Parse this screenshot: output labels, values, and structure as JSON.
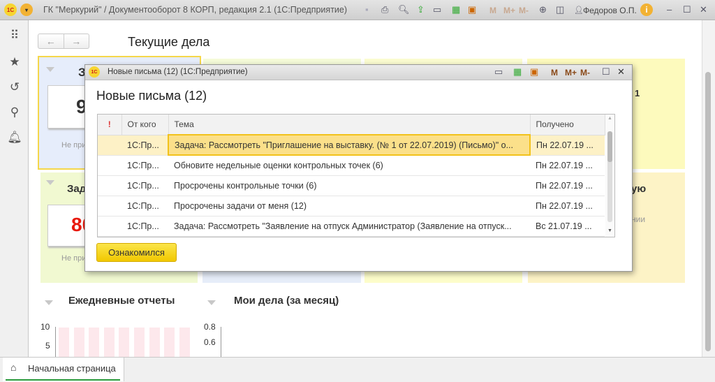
{
  "titlebar": {
    "title": "ГК \"Меркурий\" / Документооборот 8 КОРП, редакция 2.1  (1С:Предприятие)",
    "logo": "1С",
    "user": "Федоров О.П.",
    "memory": [
      "M",
      "M+",
      "M-"
    ]
  },
  "sidebar": {
    "icons": [
      "apps-grid-icon",
      "star-icon",
      "history-icon",
      "search-icon",
      "bell-icon"
    ]
  },
  "page": {
    "title": "Текущие дела",
    "back": "←",
    "forward": "→"
  },
  "tiles": {
    "r1t1": {
      "title": "З",
      "value": "9",
      "note": "Не при"
    },
    "r1t4": {
      "text": ": 1"
    },
    "r2t1": {
      "title": "Зад",
      "value": "80",
      "note": "Не при"
    },
    "r2t4": {
      "title": "ую",
      "note": "нии"
    }
  },
  "charts": [
    {
      "title": "Ежедневные отчеты",
      "ticks": [
        "10",
        "5"
      ]
    },
    {
      "title": "Мои дела (за месяц)",
      "ticks": [
        "0.8",
        "0.6"
      ]
    }
  ],
  "chart_data": [
    {
      "type": "bar",
      "title": "Ежедневные отчеты",
      "yticks": [
        10,
        5
      ],
      "bar_count": 9,
      "color": "#fde8ec"
    },
    {
      "type": "line",
      "title": "Мои дела (за месяц)",
      "yticks": [
        0.8,
        0.6
      ]
    }
  ],
  "dialog": {
    "window_title": "Новые письма (12)  (1С:Предприятие)",
    "heading": "Новые письма (12)",
    "columns": {
      "importance": "!",
      "from": "От кого",
      "subject": "Тема",
      "received": "Получено"
    },
    "rows": [
      {
        "from": "1С:Пр...",
        "subject": "Задача: Рассмотреть \"Приглашение на выставку. (№ 1 от 22.07.2019) (Письмо)\" о...",
        "received": "Пн 22.07.19 ..."
      },
      {
        "from": "1С:Пр...",
        "subject": "Обновите недельные оценки контрольных точек (6)",
        "received": "Пн 22.07.19 ..."
      },
      {
        "from": "1С:Пр...",
        "subject": "Просрочены контрольные точки (6)",
        "received": "Пн 22.07.19 ..."
      },
      {
        "from": "1С:Пр...",
        "subject": "Просрочены задачи от меня (12)",
        "received": "Пн 22.07.19 ..."
      },
      {
        "from": "1С:Пр...",
        "subject": "Задача: Рассмотреть \"Заявление на отпуск Администратор (Заявление на отпуск...",
        "received": "Вс 21.07.19 ..."
      }
    ],
    "ack_button": "Ознакомился",
    "memory": [
      "M",
      "M+",
      "M-"
    ]
  },
  "bottom": {
    "tab": "Начальная страница"
  },
  "colors": {
    "accent": "#f5d10a",
    "tab_underline": "#2a9a3c",
    "value_red": "#e8190c"
  }
}
